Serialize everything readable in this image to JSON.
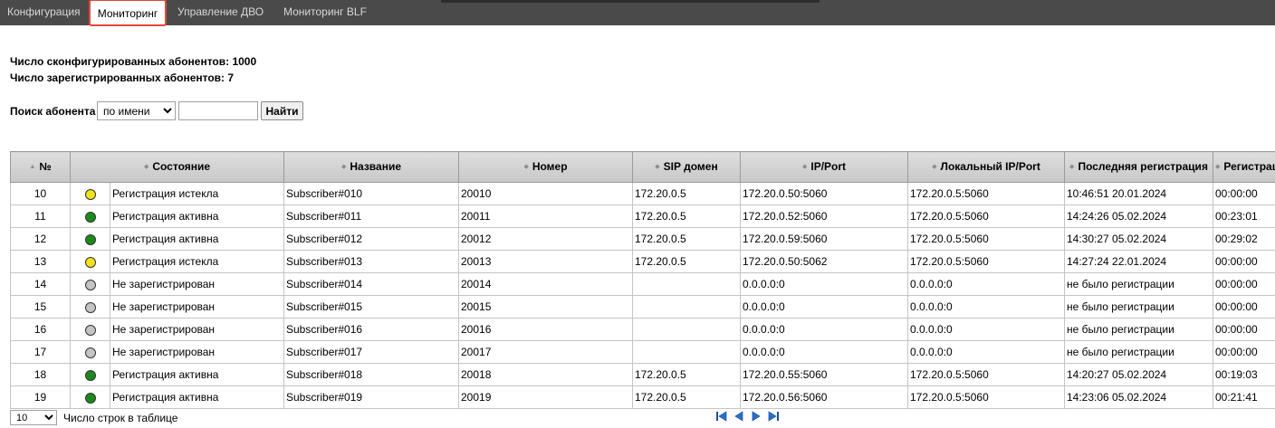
{
  "nav": {
    "tabs": [
      {
        "label": "Конфигурация",
        "active": false
      },
      {
        "label": "Мониторинг",
        "active": true
      },
      {
        "label": "Управление ДВО",
        "active": false
      },
      {
        "label": "Мониторинг BLF",
        "active": false
      }
    ]
  },
  "stats": {
    "configured": "Число сконфигурированных абонентов: 1000",
    "registered": "Число зарегистрированных абонентов: 7"
  },
  "search": {
    "label": "Поиск абонента",
    "mode": "по имени",
    "value": "",
    "button": "Найти"
  },
  "table": {
    "headers": [
      "№",
      "Состояние",
      "Название",
      "Номер",
      "SIP домен",
      "IP/Port",
      "Локальный IP/Port",
      "Последняя регистрация",
      "Регистрация"
    ],
    "rows": [
      {
        "n": "10",
        "status": "expired",
        "state": "Регистрация истекла",
        "name": "Subscriber#010",
        "number": "20010",
        "domain": "172.20.0.5",
        "ip": "172.20.0.50:5060",
        "local": "172.20.0.5:5060",
        "last": "10:46:51 20.01.2024",
        "reg": "00:00:00"
      },
      {
        "n": "11",
        "status": "active",
        "state": "Регистрация активна",
        "name": "Subscriber#011",
        "number": "20011",
        "domain": "172.20.0.5",
        "ip": "172.20.0.52:5060",
        "local": "172.20.0.5:5060",
        "last": "14:24:26 05.02.2024",
        "reg": "00:23:01"
      },
      {
        "n": "12",
        "status": "active",
        "state": "Регистрация активна",
        "name": "Subscriber#012",
        "number": "20012",
        "domain": "172.20.0.5",
        "ip": "172.20.0.59:5060",
        "local": "172.20.0.5:5060",
        "last": "14:30:27 05.02.2024",
        "reg": "00:29:02"
      },
      {
        "n": "13",
        "status": "expired",
        "state": "Регистрация истекла",
        "name": "Subscriber#013",
        "number": "20013",
        "domain": "172.20.0.5",
        "ip": "172.20.0.50:5062",
        "local": "172.20.0.5:5060",
        "last": "14:27:24 22.01.2024",
        "reg": "00:00:00"
      },
      {
        "n": "14",
        "status": "none",
        "state": "Не зарегистрирован",
        "name": "Subscriber#014",
        "number": "20014",
        "domain": "",
        "ip": "0.0.0.0:0",
        "local": "0.0.0.0:0",
        "last": "не было регистрации",
        "reg": "00:00:00"
      },
      {
        "n": "15",
        "status": "none",
        "state": "Не зарегистрирован",
        "name": "Subscriber#015",
        "number": "20015",
        "domain": "",
        "ip": "0.0.0.0:0",
        "local": "0.0.0.0:0",
        "last": "не было регистрации",
        "reg": "00:00:00"
      },
      {
        "n": "16",
        "status": "none",
        "state": "Не зарегистрирован",
        "name": "Subscriber#016",
        "number": "20016",
        "domain": "",
        "ip": "0.0.0.0:0",
        "local": "0.0.0.0:0",
        "last": "не было регистрации",
        "reg": "00:00:00"
      },
      {
        "n": "17",
        "status": "none",
        "state": "Не зарегистрирован",
        "name": "Subscriber#017",
        "number": "20017",
        "domain": "",
        "ip": "0.0.0.0:0",
        "local": "0.0.0.0:0",
        "last": "не было регистрации",
        "reg": "00:00:00"
      },
      {
        "n": "18",
        "status": "active",
        "state": "Регистрация активна",
        "name": "Subscriber#018",
        "number": "20018",
        "domain": "172.20.0.5",
        "ip": "172.20.0.55:5060",
        "local": "172.20.0.5:5060",
        "last": "14:20:27 05.02.2024",
        "reg": "00:19:03"
      },
      {
        "n": "19",
        "status": "active",
        "state": "Регистрация активна",
        "name": "Subscriber#019",
        "number": "20019",
        "domain": "172.20.0.5",
        "ip": "172.20.0.56:5060",
        "local": "172.20.0.5:5060",
        "last": "14:23:06 05.02.2024",
        "reg": "00:21:41"
      }
    ]
  },
  "status_colors": {
    "active": "#1a8a1a",
    "expired": "#f2e21a",
    "none": "#c4c4c4"
  },
  "footer": {
    "rows_value": "10",
    "rows_label": "Число строк в таблице",
    "pager_icons": [
      "first-page-icon",
      "prev-page-icon",
      "next-page-icon",
      "last-page-icon"
    ]
  }
}
